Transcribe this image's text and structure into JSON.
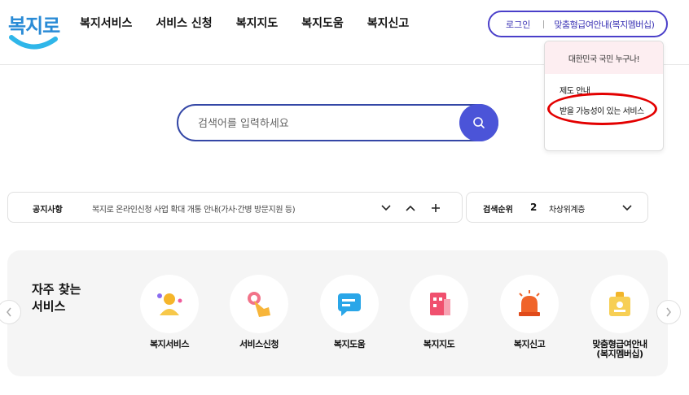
{
  "logo": {
    "text": "복지로"
  },
  "nav": [
    "복지서비스",
    "서비스 신청",
    "복지지도",
    "복지도움",
    "복지신고"
  ],
  "header_buttons": {
    "login": "로그인",
    "custom": "맞춤형급여안내(복지멤버십)"
  },
  "dropdown": {
    "heading": "대한민국 국민 누구나!",
    "items": [
      "제도 안내",
      "받을 가능성이 있는 서비스"
    ]
  },
  "search": {
    "placeholder": "검색어를 입력하세요"
  },
  "notice": {
    "label": "공지사항",
    "text": "복지로 온라인신청 사업 확대 개통 안내(가사·간병 방문지원 등)"
  },
  "ranking": {
    "label": "검색순위",
    "rank": "2",
    "term": "차상위계층"
  },
  "frequent": {
    "title_line1": "자주 찾는",
    "title_line2": "서비스",
    "services": [
      {
        "label": "복지서비스",
        "icon": "person-icon"
      },
      {
        "label": "서비스신청",
        "icon": "hand-touch-icon"
      },
      {
        "label": "복지도움",
        "icon": "chat-icon"
      },
      {
        "label": "복지지도",
        "icon": "building-icon"
      },
      {
        "label": "복지신고",
        "icon": "siren-icon"
      },
      {
        "label_line1": "맞춤형급여안내",
        "label_line2": "(복지멤버십)",
        "icon": "id-card-icon"
      }
    ]
  },
  "colors": {
    "accent": "#4b54d8",
    "highlight": "#e30000",
    "brand": "#2a8bd6"
  }
}
